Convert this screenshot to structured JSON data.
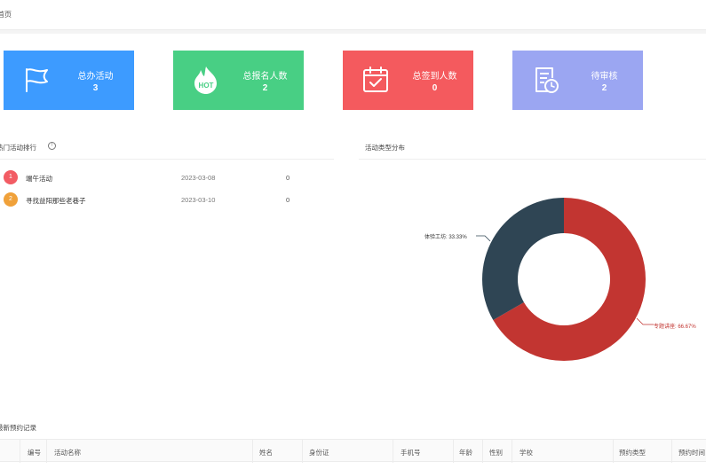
{
  "breadcrumb": "首页",
  "stats": [
    {
      "label": "总办活动",
      "value": "3",
      "color": "#3d9bff",
      "icon": "flag-icon"
    },
    {
      "label": "总报名人数",
      "value": "2",
      "color": "#48cf84",
      "icon": "hot-icon"
    },
    {
      "label": "总签到人数",
      "value": "0",
      "color": "#f45a5e",
      "icon": "calendar-check-icon"
    },
    {
      "label": "待审核",
      "value": "2",
      "color": "#9ba6f2",
      "icon": "document-clock-icon"
    }
  ],
  "hot_ranking": {
    "title": "热门活动排行",
    "rows": [
      {
        "rank": "1",
        "name": "端午活动",
        "date": "2023-03-08",
        "count": "0",
        "badge_color": "#f25c64"
      },
      {
        "rank": "2",
        "name": "寻找益阳那些老巷子",
        "date": "2023-03-10",
        "count": "0",
        "badge_color": "#f0a13a"
      }
    ]
  },
  "type_distribution": {
    "title": "活动类型分布",
    "label_dark": "体验工坊: 33.33%",
    "label_red": "专题讲座: 66.67%"
  },
  "chart_data": {
    "type": "pie",
    "title": "活动类型分布",
    "series": [
      {
        "name": "专题讲座",
        "value": 66.67,
        "color": "#c23531"
      },
      {
        "name": "体验工坊",
        "value": 33.33,
        "color": "#2f4554"
      }
    ]
  },
  "records": {
    "title": "最新预约记录",
    "columns": [
      "编号",
      "活动名称",
      "姓名",
      "身份证",
      "手机号",
      "年龄",
      "性别",
      "学校",
      "预约类型",
      "预约时间"
    ]
  }
}
